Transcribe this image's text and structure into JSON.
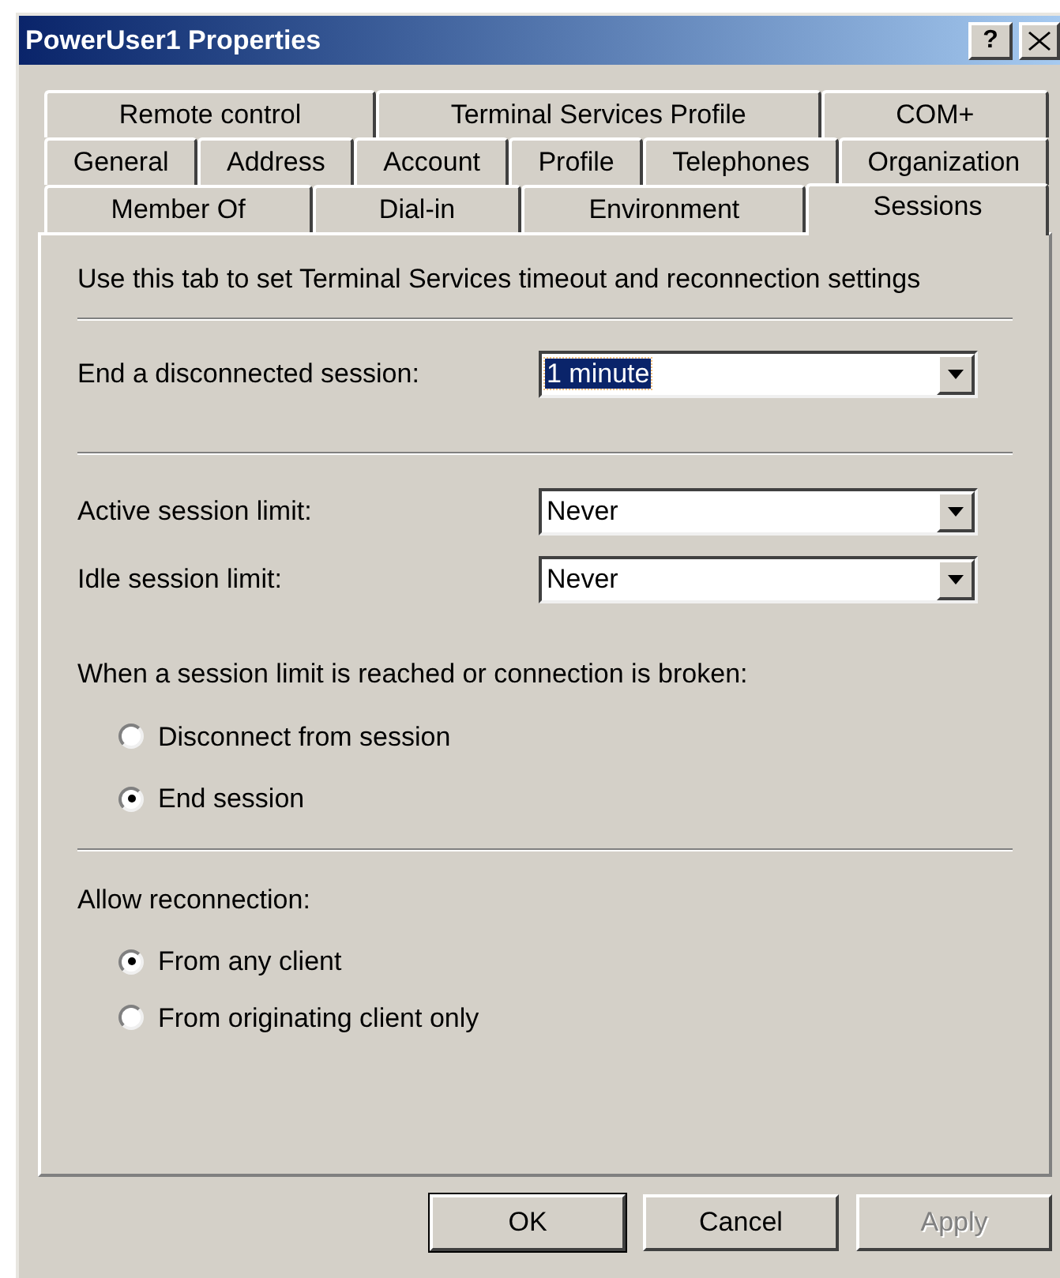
{
  "window": {
    "title": "PowerUser1 Properties",
    "help_button": "?"
  },
  "tab_rows": [
    [
      {
        "label": "Remote control",
        "selected": false
      },
      {
        "label": "Terminal Services Profile",
        "selected": false
      },
      {
        "label": "COM+",
        "selected": false
      }
    ],
    [
      {
        "label": "General",
        "selected": false
      },
      {
        "label": "Address",
        "selected": false
      },
      {
        "label": "Account",
        "selected": false
      },
      {
        "label": "Profile",
        "selected": false
      },
      {
        "label": "Telephones",
        "selected": false
      },
      {
        "label": "Organization",
        "selected": false
      }
    ],
    [
      {
        "label": "Member Of",
        "selected": false
      },
      {
        "label": "Dial-in",
        "selected": false
      },
      {
        "label": "Environment",
        "selected": false
      },
      {
        "label": "Sessions",
        "selected": true
      }
    ]
  ],
  "description": "Use this tab to set Terminal Services timeout and reconnection settings",
  "limit_groups": [
    [
      {
        "label": "End a disconnected session:",
        "value": "1 minute",
        "focused": true
      }
    ],
    [
      {
        "label": "Active session limit:",
        "value": "Never",
        "focused": false
      },
      {
        "label": "Idle session limit:",
        "value": "Never",
        "focused": false
      }
    ]
  ],
  "radio_groups": [
    {
      "title": "When a session limit is reached or connection is broken:",
      "options": [
        {
          "label": "Disconnect from session",
          "selected": false
        },
        {
          "label": "End session",
          "selected": true
        }
      ]
    },
    {
      "title": "Allow reconnection:",
      "options": [
        {
          "label": "From any client",
          "selected": true
        },
        {
          "label": "From originating client only",
          "selected": false
        }
      ]
    }
  ],
  "buttons": [
    {
      "label": "OK",
      "default": true,
      "disabled": false
    },
    {
      "label": "Cancel",
      "default": false,
      "disabled": false
    },
    {
      "label": "Apply",
      "default": false,
      "disabled": true
    }
  ]
}
